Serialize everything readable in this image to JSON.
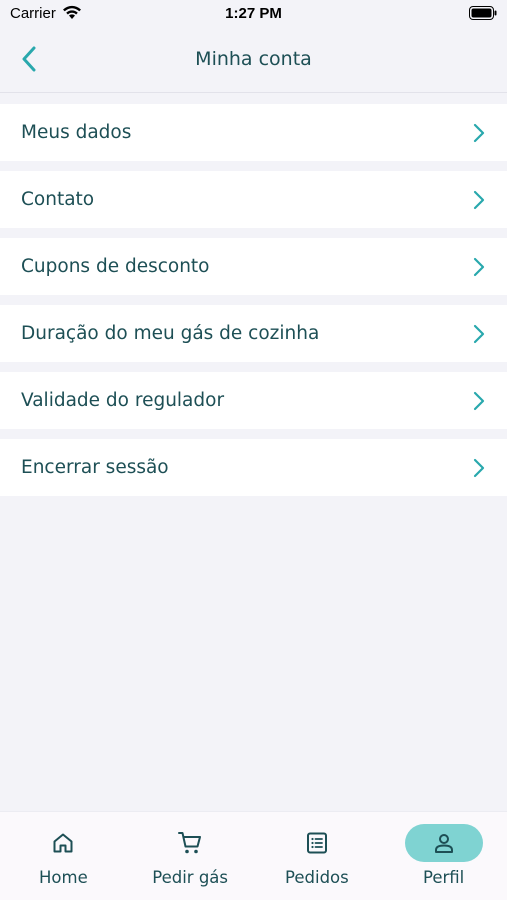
{
  "status_bar": {
    "carrier": "Carrier",
    "time": "1:27 PM"
  },
  "nav": {
    "title": "Minha conta",
    "back_icon": "chevron-left-icon"
  },
  "menu": {
    "items": [
      {
        "label": "Meus dados"
      },
      {
        "label": "Contato"
      },
      {
        "label": "Cupons de desconto"
      },
      {
        "label": "Duração do meu gás de cozinha"
      },
      {
        "label": "Validade do regulador"
      },
      {
        "label": "Encerrar sessão"
      }
    ]
  },
  "tabs": {
    "items": [
      {
        "label": "Home",
        "icon": "home-icon"
      },
      {
        "label": "Pedir gás",
        "icon": "cart-icon"
      },
      {
        "label": "Pedidos",
        "icon": "list-icon"
      },
      {
        "label": "Perfil",
        "icon": "person-icon"
      }
    ],
    "active": "Perfil"
  },
  "colors": {
    "accent": "#29a8ad",
    "text": "#1d4f55",
    "active_tab_bg": "#7fd3d2",
    "background": "#f3f3f8"
  }
}
